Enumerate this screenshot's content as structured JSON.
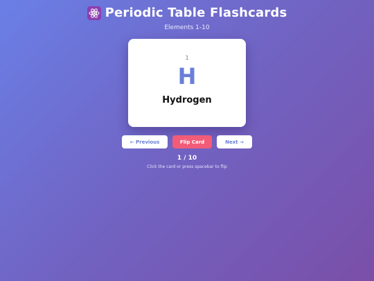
{
  "header": {
    "icon": "atom-icon",
    "title": "Periodic Table Flashcards",
    "subtitle": "Elements 1-10"
  },
  "card": {
    "atomic_number": "1",
    "symbol": "H",
    "name": "Hydrogen"
  },
  "controls": {
    "prev_label": "← Previous",
    "flip_label": "Flip Card",
    "next_label": "Next →"
  },
  "progress": {
    "counter": "1 / 10",
    "hint": "Click the card or press spacebar to flip"
  },
  "colors": {
    "background_start": "#6a7fe6",
    "background_end": "#7a4fa8",
    "accent_blue": "#6a7fd8",
    "flip_button": "#f25c78"
  }
}
